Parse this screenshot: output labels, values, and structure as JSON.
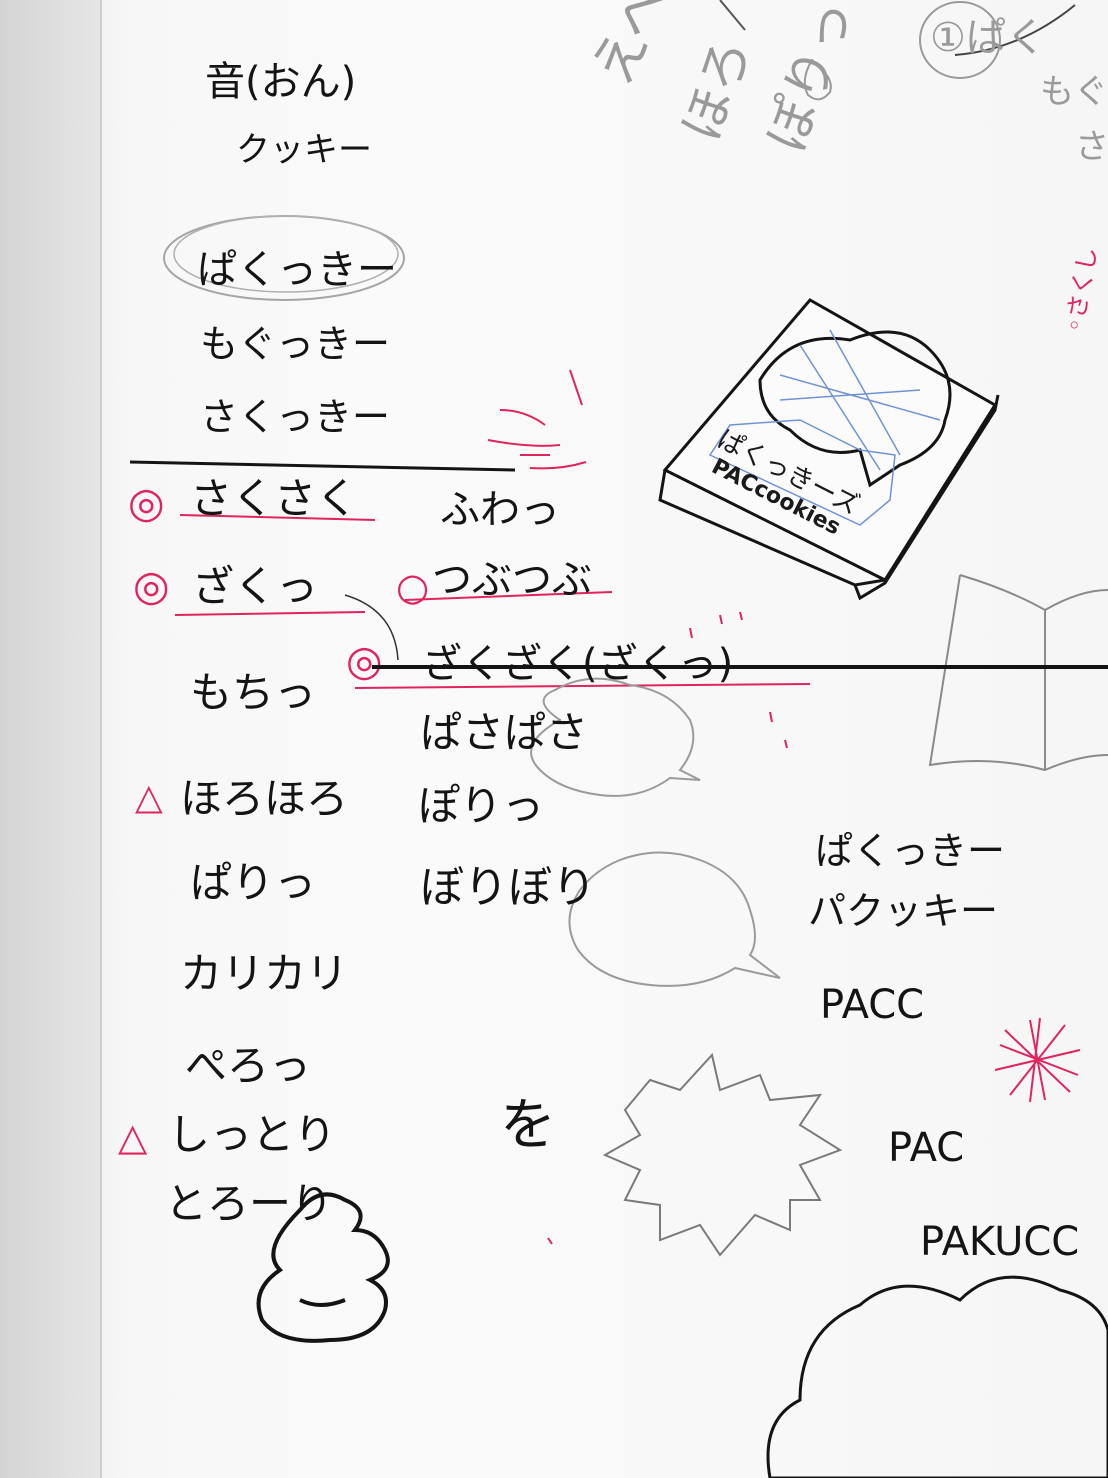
{
  "colors": {
    "ink": "#141414",
    "pencil": "#9a9a9a",
    "accent_red": "#e0245e",
    "blue_pencil": "#6f93d6",
    "paper": "#fafafa"
  },
  "column_left": {
    "heading_kanji": "音(おん)",
    "heading_sub": "クッキー",
    "circled_candidate": "ぱくっきー",
    "candidate_2": "もぐっきー",
    "candidate_3": "さくっきー",
    "sound_words": [
      {
        "text": "さくさく",
        "mark": "◎"
      },
      {
        "text": "ざくっ",
        "mark": "◎"
      },
      {
        "text": "もちっ",
        "mark": ""
      },
      {
        "text": "ほろほろ",
        "mark": "△"
      },
      {
        "text": "ぱりっ",
        "mark": ""
      },
      {
        "text": "カリカリ",
        "mark": ""
      },
      {
        "text": "ぺろっ",
        "mark": ""
      },
      {
        "text": "しっとり",
        "mark": "△"
      },
      {
        "text": "とろーり",
        "mark": ""
      }
    ]
  },
  "column_middle": {
    "words": [
      {
        "text": "ふわっ",
        "mark": ""
      },
      {
        "text": "つぶつぶ",
        "mark": "○"
      },
      {
        "text": "ざくざく(ざくっ)",
        "mark": "◎",
        "struck": true
      },
      {
        "text": "ぱさぱさ",
        "mark": ""
      },
      {
        "text": "ぽりっ",
        "mark": ""
      },
      {
        "text": "ぼりぼり",
        "mark": ""
      }
    ],
    "single_char": "を"
  },
  "box_illustration": {
    "label_kana": "ぱくっきーズ",
    "label_roman": "PACcookies"
  },
  "column_right": {
    "name_kana": "ぱくっきー",
    "name_katakana": "パクッキー",
    "latin_1": "PACC",
    "latin_2": "PAC",
    "latin_3": "PAKUCC"
  },
  "pencil_sketch_top": {
    "word_1": "えへ",
    "word_2": "ほろ",
    "word_3": "ぽりっ",
    "corner_text_1": "①ぱく",
    "corner_text_2": "もぐ",
    "corner_text_3": "さ"
  },
  "pink_corner": "◦さくし"
}
